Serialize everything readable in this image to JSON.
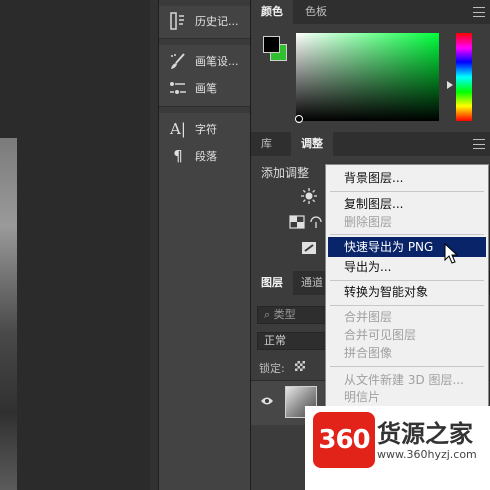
{
  "tools_panel": {
    "history": "历史记...",
    "brush_settings": "画笔设...",
    "brushes": "画笔",
    "character": "字符",
    "paragraph": "段落"
  },
  "color_panel": {
    "tabs": [
      "颜色",
      "色板"
    ],
    "foreground_color": "#000000",
    "background_color": "#2fbf2f"
  },
  "adjustments_panel": {
    "tabs": [
      "库",
      "调整"
    ],
    "add_adjustment": "添加调整"
  },
  "layers_panel": {
    "tabs": [
      "图层",
      "通道"
    ],
    "kind_filter": "类型",
    "blend_mode": "正常",
    "lock_label": "锁定:"
  },
  "context_menu": {
    "items": [
      {
        "label": "背景图层...",
        "enabled": true
      },
      {
        "label": "复制图层...",
        "enabled": true
      },
      {
        "label": "删除图层",
        "enabled": false
      },
      {
        "label": "快速导出为 PNG",
        "enabled": true,
        "highlighted": true
      },
      {
        "label": "导出为...",
        "enabled": true
      },
      {
        "label": "转换为智能对象",
        "enabled": true
      },
      {
        "label": "合并图层",
        "enabled": false
      },
      {
        "label": "合并可见图层",
        "enabled": false
      },
      {
        "label": "拼合图像",
        "enabled": false
      },
      {
        "label": "从文件新建 3D 图层...",
        "enabled": false
      },
      {
        "label": "明信片",
        "enabled": false
      }
    ]
  },
  "watermark": {
    "logo_text": "360",
    "name": "货源之家",
    "url": "www.360hyzj.com"
  }
}
